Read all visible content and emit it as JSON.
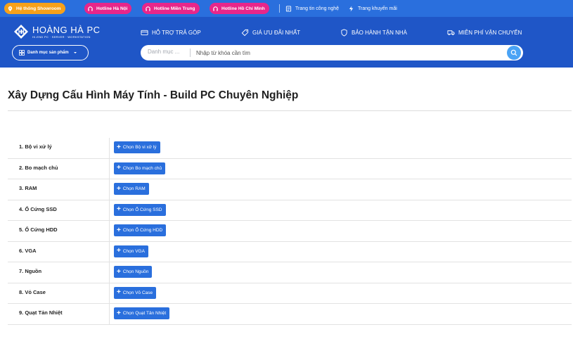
{
  "topbar": {
    "pills": [
      {
        "label": "Hệ thống Showroom",
        "icon": "location-pin-icon",
        "color": "#f7a11a"
      },
      {
        "label": "Hotline Hà Nội",
        "icon": "headset-icon",
        "color": "#e8268a"
      },
      {
        "label": "Hotline Miền Trung",
        "icon": "headset-icon",
        "color": "#e8268a"
      },
      {
        "label": "Hotline Hồ Chí Minh",
        "icon": "headset-icon",
        "color": "#e8268a"
      }
    ],
    "links": [
      {
        "label": "Trang tin công nghệ",
        "icon": "document-icon"
      },
      {
        "label": "Trang khuyến mãi",
        "icon": "lightning-icon"
      }
    ]
  },
  "header": {
    "logo": {
      "name": "HOÀNG HÀ PC",
      "tagline": "HI-END PC · SERVER · WORKSTATION"
    },
    "nav": [
      {
        "label": "HỖ TRỢ TRẢ GÓP",
        "icon": "card-icon"
      },
      {
        "label": "GIÁ ƯU ĐÃI NHẤT",
        "icon": "tag-icon"
      },
      {
        "label": "BẢO HÀNH TẬN NHÀ",
        "icon": "shield-icon"
      },
      {
        "label": "MIỄN PHÍ VẬN CHUYỂN",
        "icon": "truck-icon"
      }
    ],
    "category_button": "Danh mục sản phẩm",
    "search": {
      "scope": "Danh mục ...",
      "placeholder": "Nhập từ khóa cần tìm"
    }
  },
  "page": {
    "title": "Xây Dựng Cấu Hình Máy Tính - Build PC Chuyên Nghiệp"
  },
  "components": [
    {
      "label": "1. Bộ vi xử lý",
      "button": "Chọn Bộ vi xử lý"
    },
    {
      "label": "2. Bo mạch chủ",
      "button": "Chọn Bo mạch chủ"
    },
    {
      "label": "3. RAM",
      "button": "Chọn RAM"
    },
    {
      "label": "4. Ổ Cứng SSD",
      "button": "Chọn Ổ Cứng SSD"
    },
    {
      "label": "5. Ổ Cứng HDD",
      "button": "Chọn Ổ Cứng HDD"
    },
    {
      "label": "6. VGA",
      "button": "Chọn VGA"
    },
    {
      "label": "7. Nguồn",
      "button": "Chọn Nguồn"
    },
    {
      "label": "8. Vỏ Case",
      "button": "Chọn Vỏ Case"
    },
    {
      "label": "9. Quạt Tản Nhiệt",
      "button": "Chọn Quạt Tản Nhiệt"
    }
  ],
  "colors": {
    "primary": "#2a6fdd",
    "header": "#1f56c7",
    "orange": "#f7a11a",
    "pink": "#e8268a",
    "search_button": "#4aa3f5"
  }
}
